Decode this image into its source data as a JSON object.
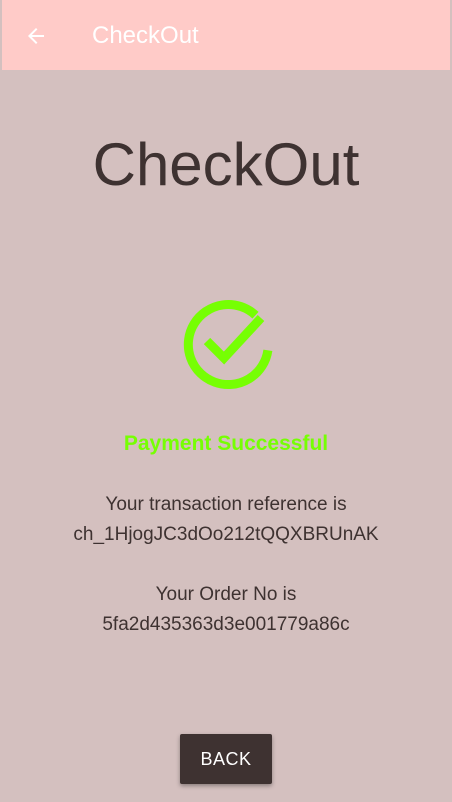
{
  "appbar": {
    "back_icon": "arrow-left-icon",
    "title": "CheckOut"
  },
  "main": {
    "heading": "CheckOut",
    "status_icon": "check-circle-icon",
    "status_text": "Payment Successful",
    "transaction_label": "Your transaction reference is",
    "transaction_reference": "ch_1HjogJC3dOo212tQQXBRUnAK",
    "order_label": "Your Order No is",
    "order_number": "5fa2d435363d3e001779a86c",
    "back_button_label": "BACK"
  },
  "colors": {
    "appbar_bg": "#ffcbc8",
    "page_bg": "#d4c0bf",
    "success_green": "#76ff03",
    "text_dark": "#3e3231",
    "button_bg": "#3e3231"
  }
}
